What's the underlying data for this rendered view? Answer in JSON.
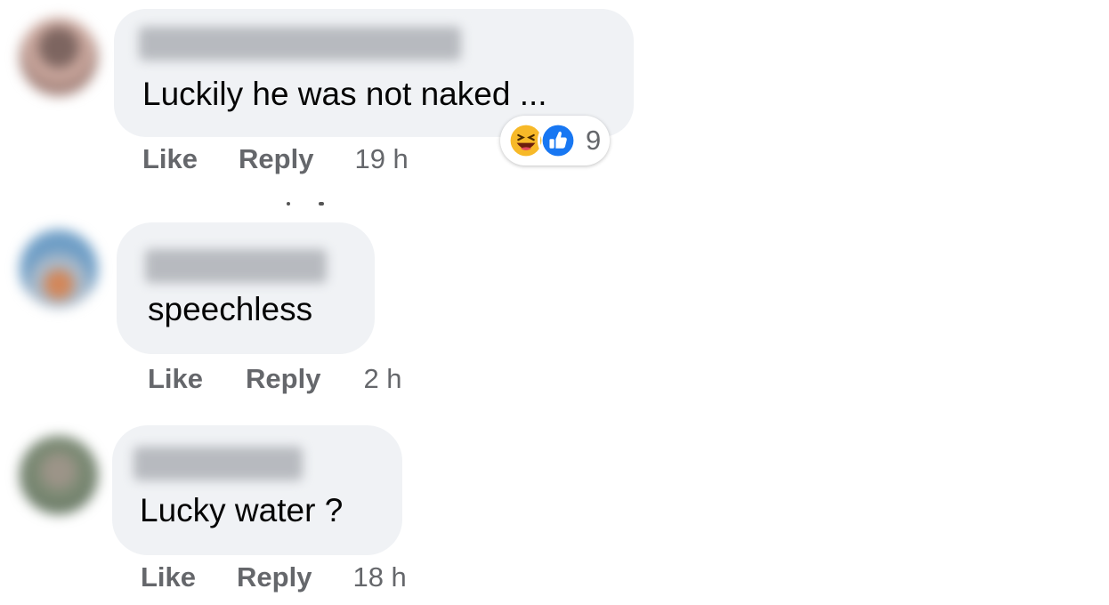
{
  "comments": [
    {
      "text": "Luckily he was not naked ...",
      "actions": {
        "like": "Like",
        "reply": "Reply",
        "time": "19 h"
      },
      "reactions": {
        "icons": [
          "haha-icon",
          "like-icon"
        ],
        "count": "9"
      },
      "avatar_colors": [
        "#8e6f6a",
        "#c7a29a"
      ]
    },
    {
      "text": "speechless",
      "actions": {
        "like": "Like",
        "reply": "Reply",
        "time": "2 h"
      },
      "avatar_colors": [
        "#7aa6c9",
        "#d48a5a"
      ]
    },
    {
      "text": "Lucky water ?",
      "actions": {
        "like": "Like",
        "reply": "Reply",
        "time": "18 h"
      },
      "avatar_colors": [
        "#6f7f6a",
        "#a39a8c"
      ]
    }
  ],
  "colors": {
    "bubble": "#f0f2f5",
    "meta_text": "#65676b",
    "like_blue": "#1877f2",
    "haha_yellow": "#f7b928"
  }
}
